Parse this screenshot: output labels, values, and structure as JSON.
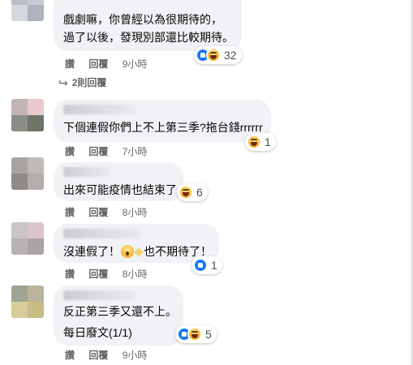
{
  "actions": {
    "like": "讚",
    "reply": "回覆"
  },
  "comments": [
    {
      "lines": [
        "戲劇嘛，你曾經以為很期待的，",
        "過了以後，發現別部還比較期待。"
      ],
      "reaction_count": "32",
      "time": "9小時",
      "replies_link": "2則回覆"
    },
    {
      "lines": [
        "下個連假你們上不上第三季?拖台錢rrrrrr"
      ],
      "reaction_count": "1",
      "time": "7小時"
    },
    {
      "lines": [
        "出來可能疫情也結束了"
      ],
      "reaction_count": "6",
      "time": "8小時"
    },
    {
      "line_start": "沒連假了！",
      "line_end": "也不期待了！",
      "reaction_count": "1",
      "time": "8小時"
    },
    {
      "lines": [
        "反正第三季又還不上。",
        "每日廢文(1/1)"
      ],
      "reaction_count": "5",
      "time": "9小時"
    }
  ]
}
